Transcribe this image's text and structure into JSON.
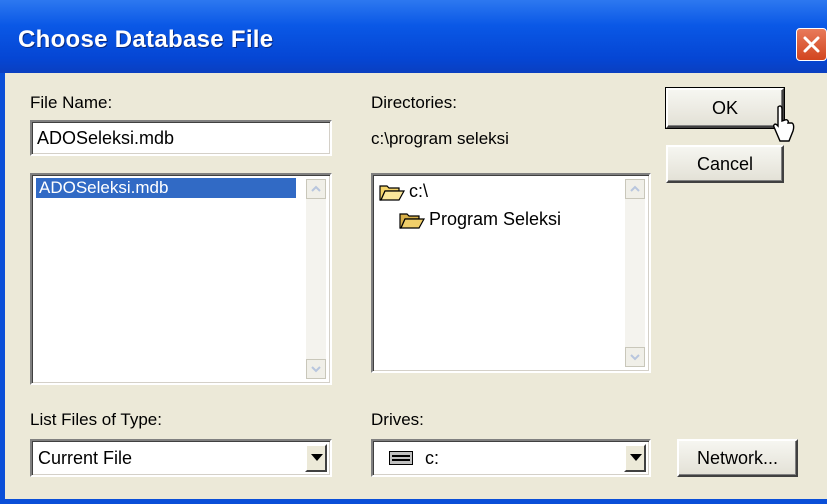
{
  "dialog": {
    "title": "Choose Database File",
    "labels": {
      "file_name": "File Name:",
      "directories": "Directories:",
      "list_files_of_type": "List Files of Type:",
      "drives": "Drives:"
    },
    "file_name_value": "ADOSeleksi.mdb",
    "current_directory": "c:\\program seleksi",
    "file_list": [
      "ADOSeleksi.mdb"
    ],
    "directory_tree": [
      {
        "label": "c:\\",
        "icon": "open-folder-icon"
      },
      {
        "label": "Program Seleksi",
        "icon": "open-folder-icon"
      }
    ],
    "file_type_value": "Current File",
    "drive_value": "c:",
    "buttons": {
      "ok": "OK",
      "cancel": "Cancel",
      "network": "Network..."
    }
  }
}
